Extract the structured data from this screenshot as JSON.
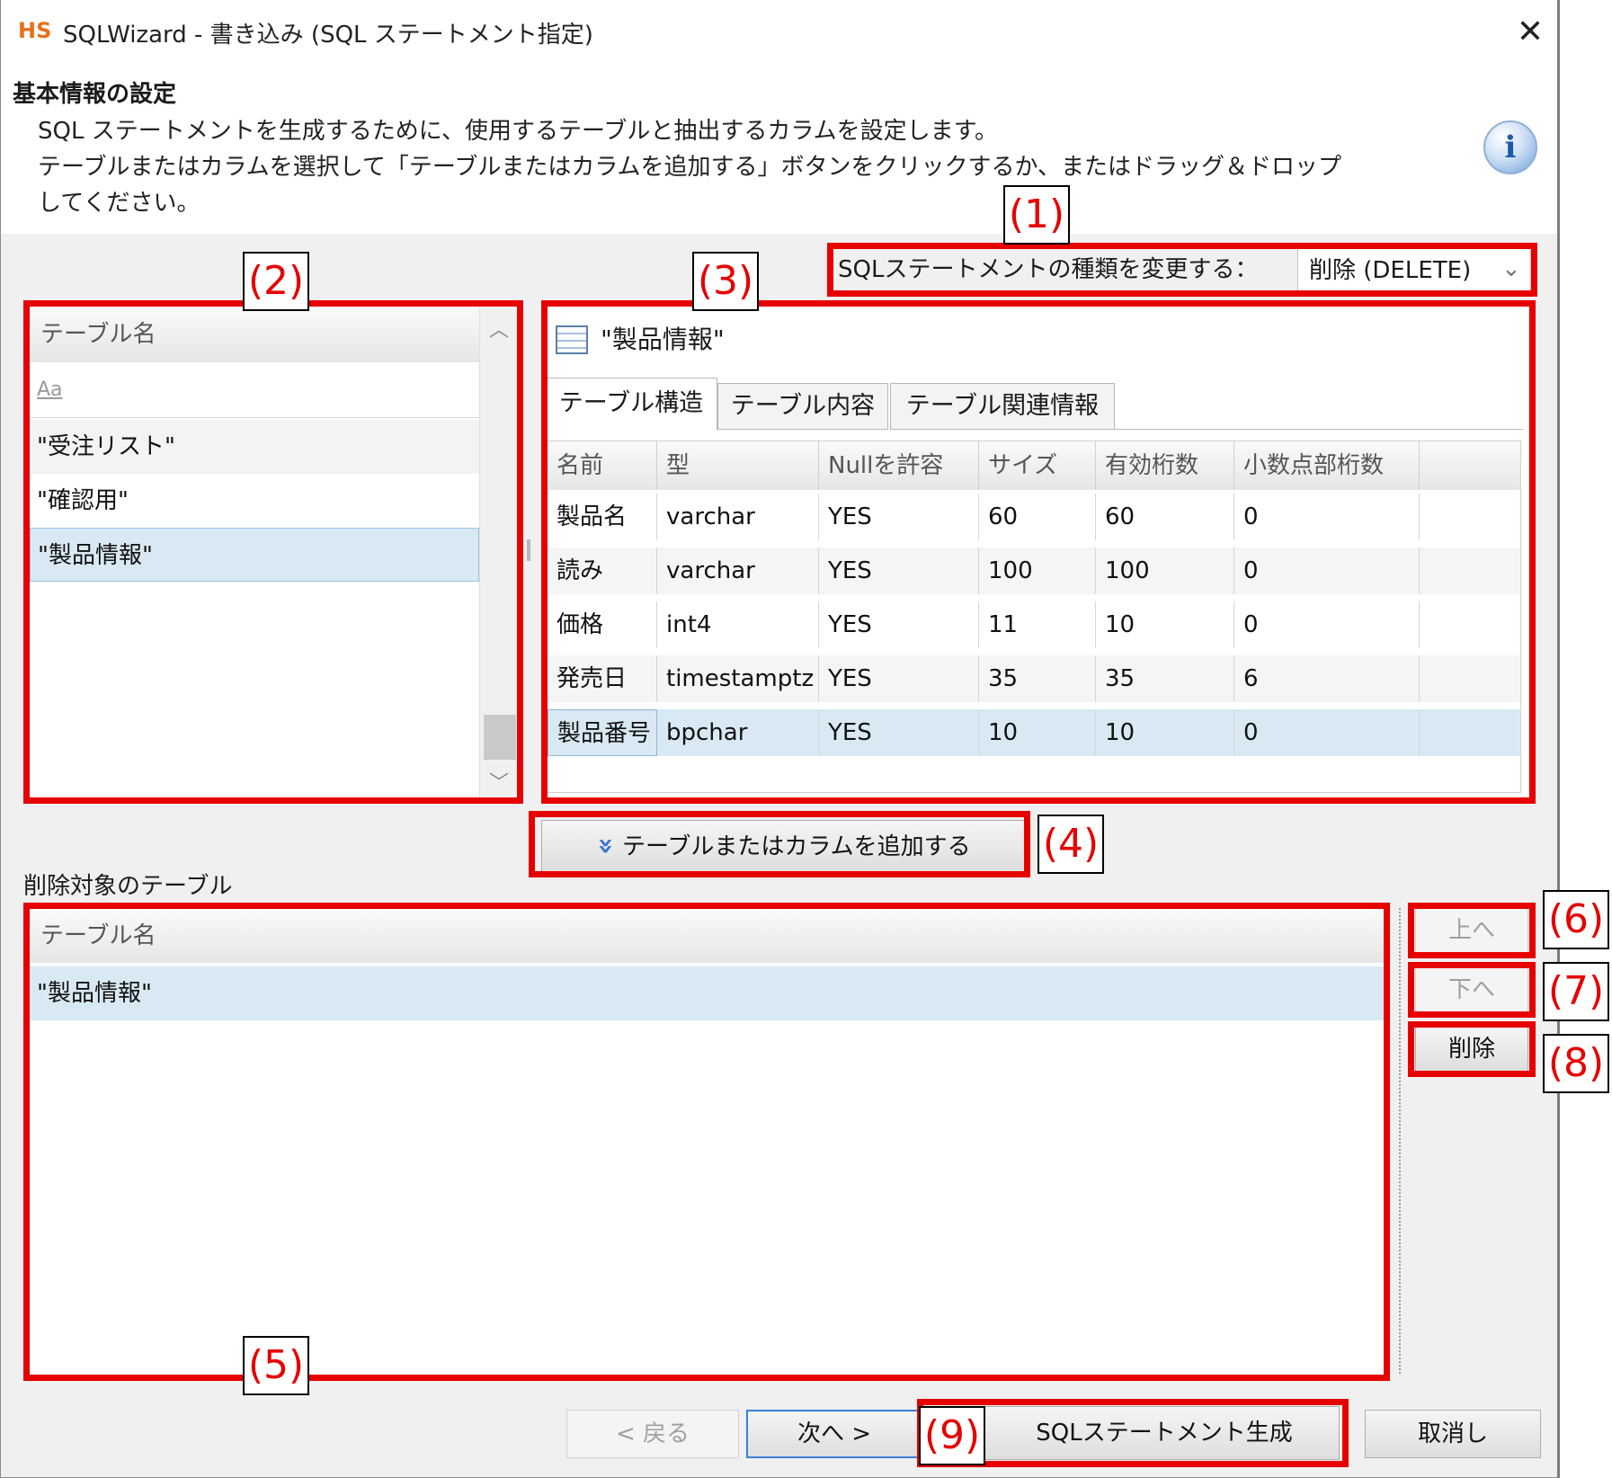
{
  "window": {
    "app_logo": "HS",
    "title": "SQLWizard - 書き込み (SQL ステートメント指定)",
    "close_glyph": "✕"
  },
  "header": {
    "heading": "基本情報の設定",
    "line1": "SQL ステートメントを生成するために、使用するテーブルと抽出するカラムを設定します。",
    "line2": "テーブルまたはカラムを選択して「テーブルまたはカラムを追加する」ボタンをクリックするか、またはドラッグ＆ドロップ",
    "line3": "してください。",
    "info_glyph": "i"
  },
  "statement_type": {
    "label": "SQLステートメントの種類を変更する：",
    "value": "削除 (DELETE)",
    "arrow": "⌄"
  },
  "table_list": {
    "header": "テーブル名",
    "filter_placeholder": "Aa",
    "items": [
      "\"受注リスト\"",
      "\"確認用\"",
      "\"製品情報\""
    ],
    "selected_index": 2
  },
  "table_detail": {
    "title": "\"製品情報\"",
    "tabs": [
      "テーブル構造",
      "テーブル内容",
      "テーブル関連情報"
    ],
    "active_tab": 0,
    "columns": [
      "名前",
      "型",
      "Nullを許容",
      "サイズ",
      "有効桁数",
      "小数点部桁数"
    ],
    "rows": [
      [
        "製品名",
        "varchar",
        "YES",
        "60",
        "60",
        "0"
      ],
      [
        "読み",
        "varchar",
        "YES",
        "100",
        "100",
        "0"
      ],
      [
        "価格",
        "int4",
        "YES",
        "11",
        "10",
        "0"
      ],
      [
        "発売日",
        "timestamptz",
        "YES",
        "35",
        "35",
        "6"
      ],
      [
        "製品番号",
        "bpchar",
        "YES",
        "10",
        "10",
        "0"
      ]
    ],
    "selected_row": 4
  },
  "add_button": {
    "label": "テーブルまたはカラムを追加する",
    "icon": "»"
  },
  "delete_targets": {
    "label": "削除対象のテーブル",
    "header": "テーブル名",
    "items": [
      "\"製品情報\""
    ]
  },
  "side_buttons": {
    "up": "上へ",
    "down": "下へ",
    "delete": "削除"
  },
  "footer": {
    "back": "< 戻る",
    "next": "次へ >",
    "generate": "SQLステートメント生成",
    "cancel": "取消し"
  },
  "callouts": [
    "(1)",
    "(2)",
    "(3)",
    "(4)",
    "(5)",
    "(6)",
    "(7)",
    "(8)",
    "(9)"
  ],
  "colors": {
    "annotation_red": "#e60000",
    "selection": "#d8e9f4",
    "logo": "#e8701a"
  }
}
